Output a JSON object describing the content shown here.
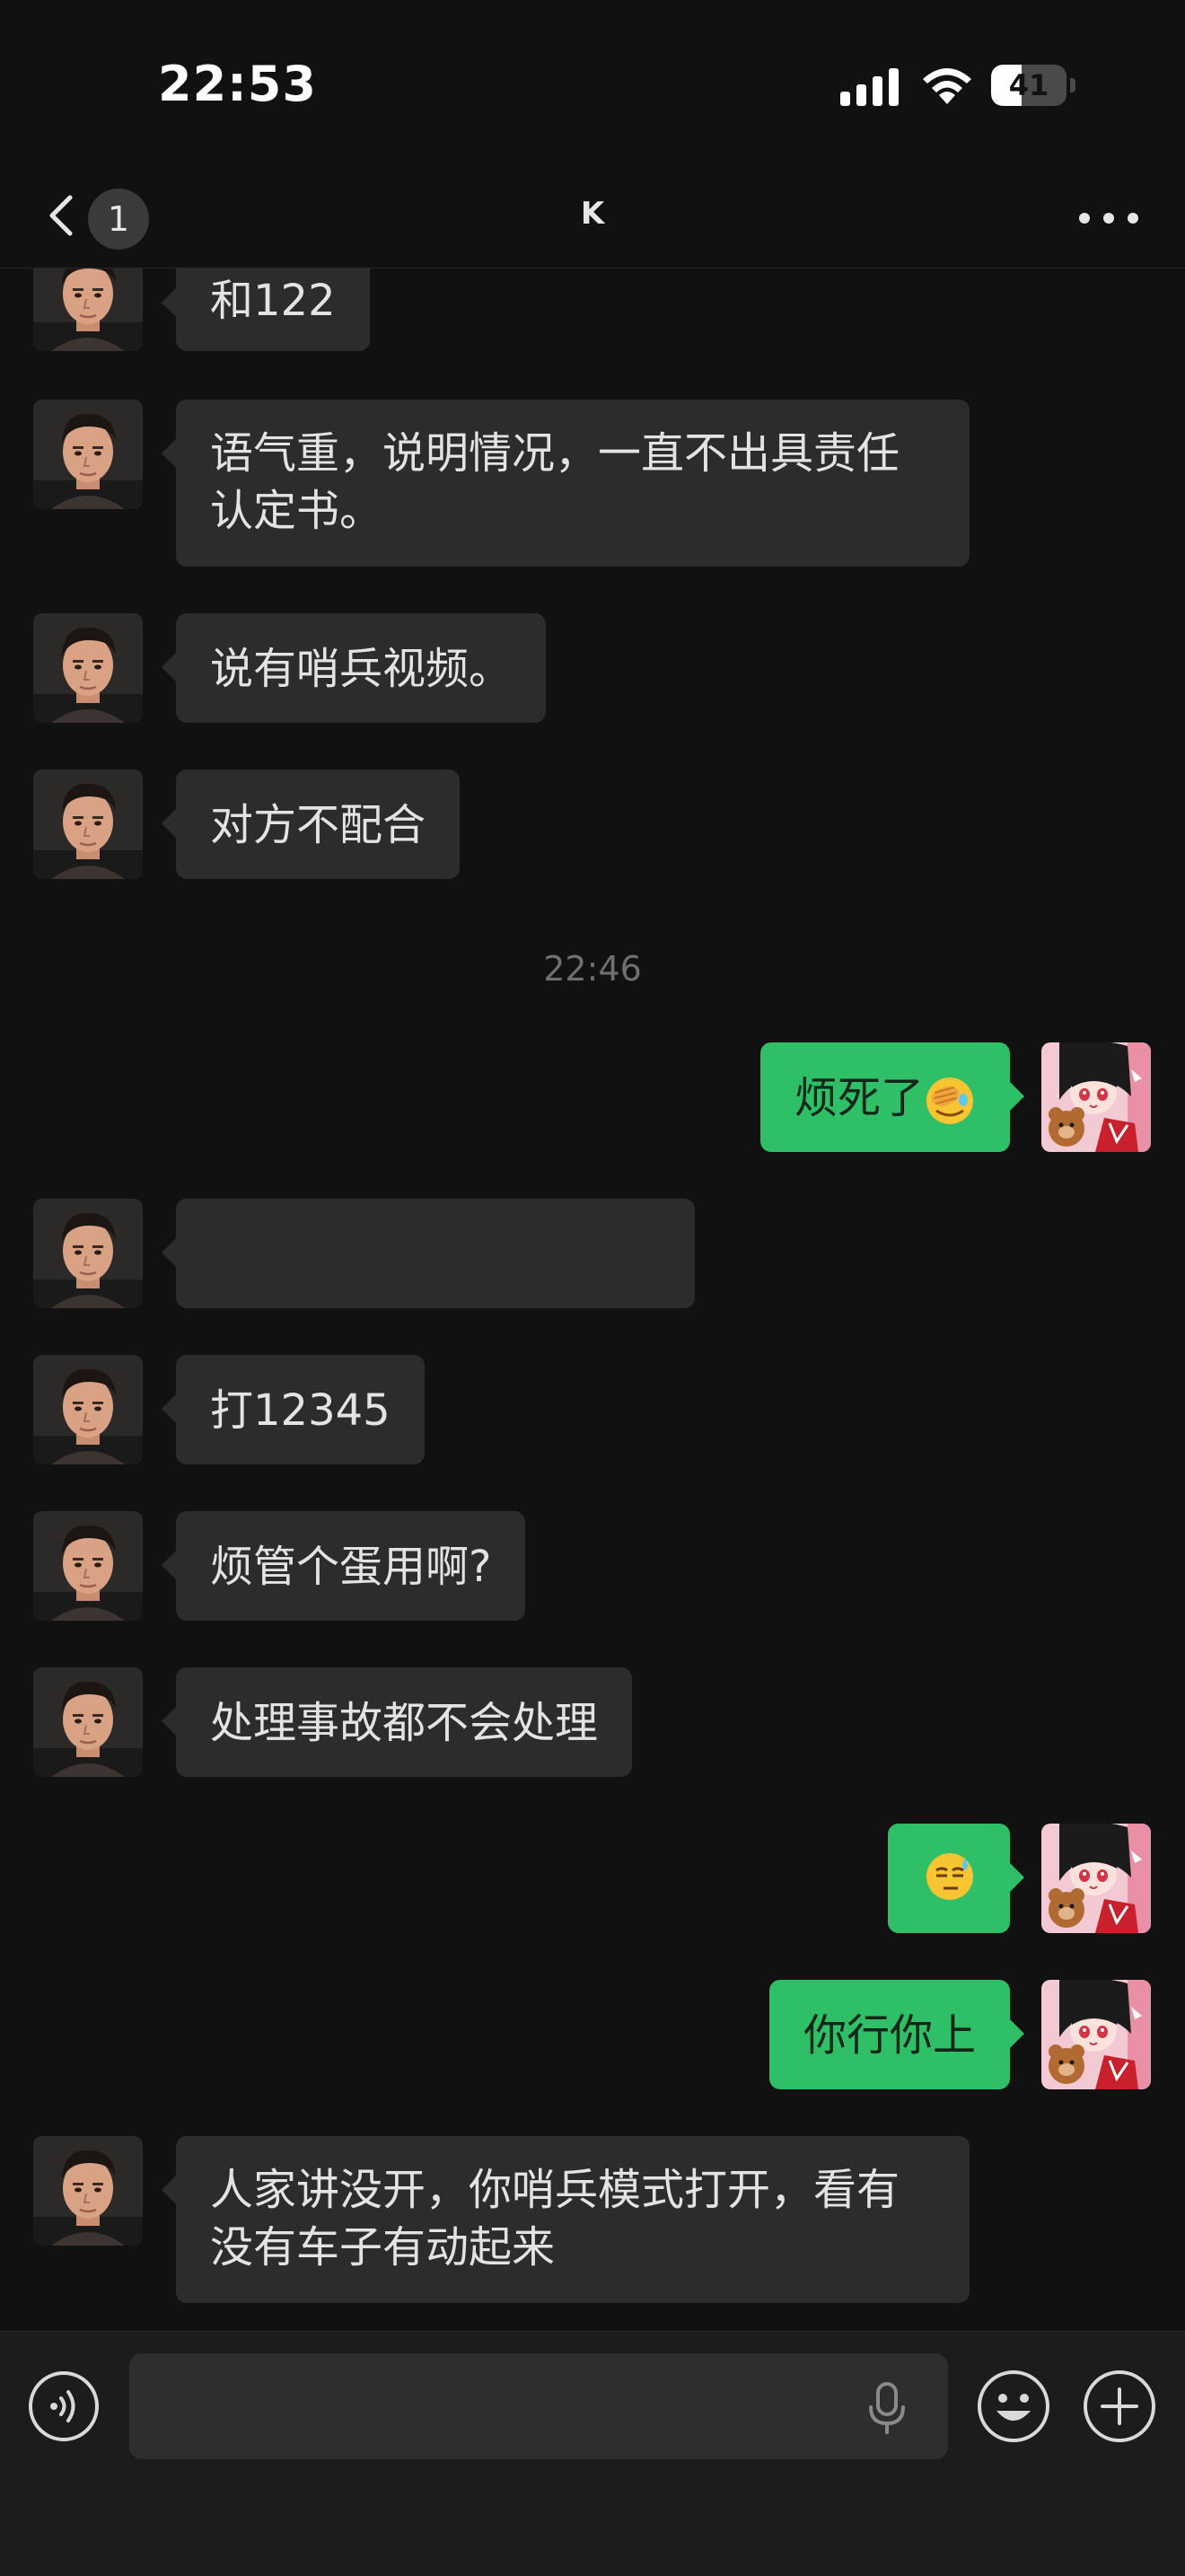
{
  "status_bar": {
    "time": "22:53",
    "battery_level": "41",
    "battery_fraction": 0.41
  },
  "nav": {
    "unread_count": "1",
    "title": "K"
  },
  "messages": {
    "m1": "和122",
    "m2": "语气重，说明情况，一直不出具责任认定书。",
    "m3": "说有哨兵视频。",
    "m4": "对方不配合",
    "timestamp": "22:46",
    "m5": "烦死了",
    "m5_emoji": "face-with-hand-over-eyes-emoji",
    "m6": "",
    "m7": "打12345",
    "m8": "烦管个蛋用啊?",
    "m9": "处理事故都不会处理",
    "m10_emoji": "sweat-smile-face-emoji",
    "m11": "你行你上",
    "m12": "人家讲没开，你哨兵模式打开，看有没有车子有动起来"
  },
  "input_bar": {
    "placeholder": ""
  },
  "colors": {
    "background": "#111111",
    "incoming_bubble": "#2c2c2c",
    "outgoing_bubble": "#2fbf66",
    "input_bar": "#1c1c1c"
  },
  "icons": {
    "back": "chevron-left-icon",
    "more": "ellipsis-icon",
    "voice": "voice-icon",
    "mic": "microphone-icon",
    "emoji": "smiley-icon",
    "plus": "plus-icon"
  }
}
